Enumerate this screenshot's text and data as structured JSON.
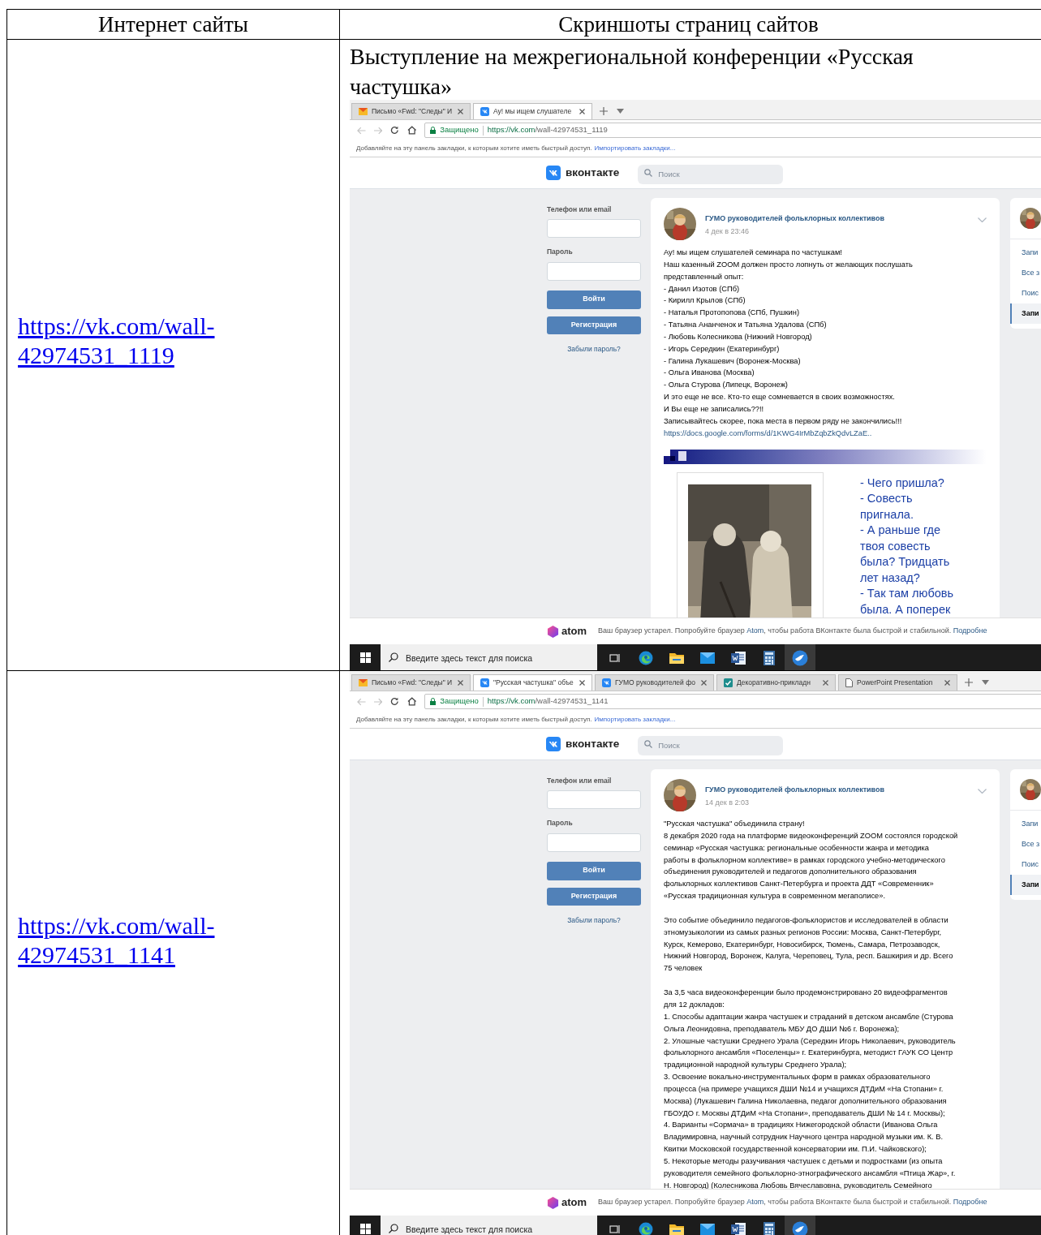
{
  "table": {
    "columns": [
      "Интернет сайты",
      "Скриншоты страниц сайтов"
    ],
    "rows": [
      {
        "site_link": "https://vk.com/wall-42974531_1119",
        "caption": "Выступление на межрегиональной конференции «Русская частушка»",
        "screenshot": {
          "tabs": [
            {
              "title": "Письмо «Fwd: \"Следы\" И",
              "kind": "mail",
              "selected": false
            },
            {
              "title": "Ау! мы ищем слушателе",
              "kind": "vk",
              "selected": true
            }
          ],
          "address_bar": {
            "security": "Защищено",
            "url_host": "https://vk.com",
            "url_path": "/wall-42974531_1119"
          },
          "bookmarks_bar": {
            "hint": "Добавляйте на эту панель закладки, к которым хотите иметь быстрый доступ.",
            "link": "Импортировать закладки..."
          },
          "vk_header": {
            "logo_text": "вконтакте",
            "search_placeholder": "Поиск"
          },
          "login": {
            "phone_label": "Телефон или email",
            "password_label": "Пароль",
            "login_button": "Войти",
            "register_button": "Регистрация",
            "forgot_link": "Забыли пароль?"
          },
          "post": {
            "author": "ГУМО руководителей фольклорных коллективов",
            "date": "4 дек в 23:46",
            "paragraphs": [
              {
                "kind": "text",
                "lines": [
                  "Ау! мы ищем слушателей семинара по частушкам!",
                  "Наш казенный ZOOM должен просто лопнуть от желающих послушать",
                  "представленный опыт:",
                  "- Данил Изотов (СПб)",
                  "- Кирилл Крылов (СПб)",
                  "- Наталья Протопопова (СПб, Пушкин)",
                  "- Татьяна Ананченок и Татьяна Удалова (СПб)",
                  "- Любовь Колесникова (Нижний Новгород)",
                  "- Игорь Середкин (Екатеринбург)",
                  "- Галина Лукашевич (Воронеж-Москва)",
                  "- Ольга Иванова (Москва)",
                  "- Ольга Стурова (Липецк, Воронеж)",
                  "И это еще не все. Кто-то еще сомневается в своих возможностях.",
                  "И Вы еще не записались??!!",
                  "Записывайтесь скорее, пока места в первом ряду не закончились!!!"
                ]
              },
              {
                "kind": "link",
                "lines": [
                  "https://docs.google.com/forms/d/1KWG4IrMbZqbZkQdvLZaE.."
                ]
              }
            ],
            "attachment": {
              "kind": "picture",
              "caption_lines": [
                "- Чего пришла?",
                "- Совесть",
                "пригнала.",
                "- А раньше где",
                "твоя совесть",
                "была? Тридцать",
                "лет назад?",
                "- Так там любовь",
                "была. А поперек"
              ]
            }
          },
          "side_menu": [
            {
              "label": "Запи",
              "selected": false
            },
            {
              "label": "Все з",
              "selected": false
            },
            {
              "label": "Поис",
              "selected": false
            },
            {
              "label": "Запи",
              "selected": true
            }
          ],
          "atom_bar": {
            "logo_text": "atom",
            "message_start": "Ваш браузер устарел. Попробуйте браузер ",
            "message_link": "Atom",
            "message_end": ", чтобы работа ВКонтакте была быстрой и стабильной. ",
            "more_link": "Подробне"
          },
          "taskbar": {
            "search_placeholder": "Введите здесь текст для поиска",
            "apps": [
              {
                "kind": "task_view",
                "active": false
              },
              {
                "kind": "edge",
                "active": false
              },
              {
                "kind": "folder",
                "active": false
              },
              {
                "kind": "mail",
                "active": false
              },
              {
                "kind": "word",
                "active": false
              },
              {
                "kind": "calculator",
                "active": false
              },
              {
                "kind": "bird",
                "active": true
              }
            ]
          }
        }
      },
      {
        "site_link": "https://vk.com/wall-42974531_1141",
        "screenshot": {
          "tabs": [
            {
              "title": "Письмо «Fwd: \"Следы\" И",
              "kind": "mail",
              "selected": false
            },
            {
              "title": "\"Русская частушка\" объе",
              "kind": "vk",
              "selected": true
            },
            {
              "title": "ГУМО руководителей фо",
              "kind": "vk",
              "selected": false
            },
            {
              "title": "Декоративно-прикладн",
              "kind": "check",
              "selected": false
            },
            {
              "title": "PowerPoint Presentation",
              "kind": "doc",
              "selected": false
            }
          ],
          "address_bar": {
            "security": "Защищено",
            "url_host": "https://vk.com",
            "url_path": "/wall-42974531_1141"
          },
          "bookmarks_bar": {
            "hint": "Добавляйте на эту панель закладки, к которым хотите иметь быстрый доступ.",
            "link": "Импортировать закладки..."
          },
          "vk_header": {
            "logo_text": "вконтакте",
            "search_placeholder": "Поиск"
          },
          "login": {
            "phone_label": "Телефон или email",
            "password_label": "Пароль",
            "login_button": "Войти",
            "register_button": "Регистрация",
            "forgot_link": "Забыли пароль?"
          },
          "post": {
            "author": "ГУМО руководителей фольклорных коллективов",
            "date": "14 дек в 2:03",
            "paragraphs": [
              {
                "kind": "text",
                "lines": [
                  "\"Русская частушка\" объединила страну!",
                  "8 декабря 2020 года на платформе видеоконференций ZOOM состоялся городской",
                  "семинар «Русская частушка: региональные особенности жанра и методика",
                  "работы в фольклорном коллективе» в рамках городского учебно-методического",
                  "объединения руководителей и педагогов дополнительного образования",
                  "фольклорных коллективов Санкт-Петербурга и проекта ДДТ «Современник»",
                  "«Русская традиционная культура в современном мегаполисе»."
                ]
              },
              {
                "kind": "text",
                "lines": [
                  "Это событие объединило педагогов-фольклористов и исследователей в области",
                  "этномузыкологии из самых разных регионов России: Москва, Санкт-Петербург,",
                  "Курск, Кемерово, Екатеринбург, Новосибирск, Тюмень, Самара, Петрозаводск,",
                  "Нижний Новгород, Воронеж, Калуга, Череповец, Тула, респ. Башкирия и др. Всего",
                  "75 человек"
                ]
              },
              {
                "kind": "text",
                "lines": [
                  "За 3,5 часа видеоконференции было продемонстрировано 20 видеофрагментов",
                  "для 12 докладов:",
                  "1. Способы адаптации жанра частушек и страданий в детском ансамбле (Стурова",
                  "Ольга Леонидовна, преподаватель МБУ ДО ДШИ №6 г. Воронежа);",
                  "2. Улошные частушки Среднего Урала (Середкин Игорь Николаевич, руководитель",
                  "фольклорного ансамбля «Поселенцы» г. Екатеринбурга, методист ГАУК СО Центр",
                  "традиционной народной культуры Среднего Урала);",
                  "3. Освоение вокально-инструментальных форм в рамках образовательного",
                  "процесса (на примере учащихся ДШИ №14 и учащихся ДТДиМ «На Стопани» г.",
                  "Москва) (Лукашевич Галина Николаевна, педагог дополнительного образования",
                  "ГБОУДО г. Москвы ДТДиМ «На Стопани», преподаватель ДШИ № 14 г. Москвы);",
                  "4. Варианты «Сормача» в традициях Нижегородской области (Иванова Ольга",
                  "Владимировна, научный сотрудник Научного центра народной музыки им. К. В.",
                  "Квитки Московской государственной консерватории им. П.И. Чайковского);",
                  "5. Некоторые методы разучивания частушек с детьми и подростками (из опыта",
                  "руководителя семейного фольклорно-этнографического ансамбля «Птица Жар», г.",
                  "Н. Новгород) (Колесникова Любовь Вячеславовна, руководитель Семейного"
                ]
              }
            ]
          },
          "side_menu": [
            {
              "label": "Запи",
              "selected": false
            },
            {
              "label": "Все з",
              "selected": false
            },
            {
              "label": "Поис",
              "selected": false
            },
            {
              "label": "Запи",
              "selected": true
            }
          ],
          "atom_bar": {
            "logo_text": "atom",
            "message_start": "Ваш браузер устарел. Попробуйте браузер ",
            "message_link": "Atom",
            "message_end": ", чтобы работа ВКонтакте была быстрой и стабильной. ",
            "more_link": "Подробне"
          },
          "taskbar": {
            "search_placeholder": "Введите здесь текст для поиска",
            "apps": [
              {
                "kind": "task_view",
                "active": false
              },
              {
                "kind": "edge",
                "active": false
              },
              {
                "kind": "folder",
                "active": false
              },
              {
                "kind": "mail",
                "active": false
              },
              {
                "kind": "word",
                "active": false
              },
              {
                "kind": "calculator",
                "active": false
              },
              {
                "kind": "bird",
                "active": true
              }
            ]
          }
        }
      }
    ]
  }
}
